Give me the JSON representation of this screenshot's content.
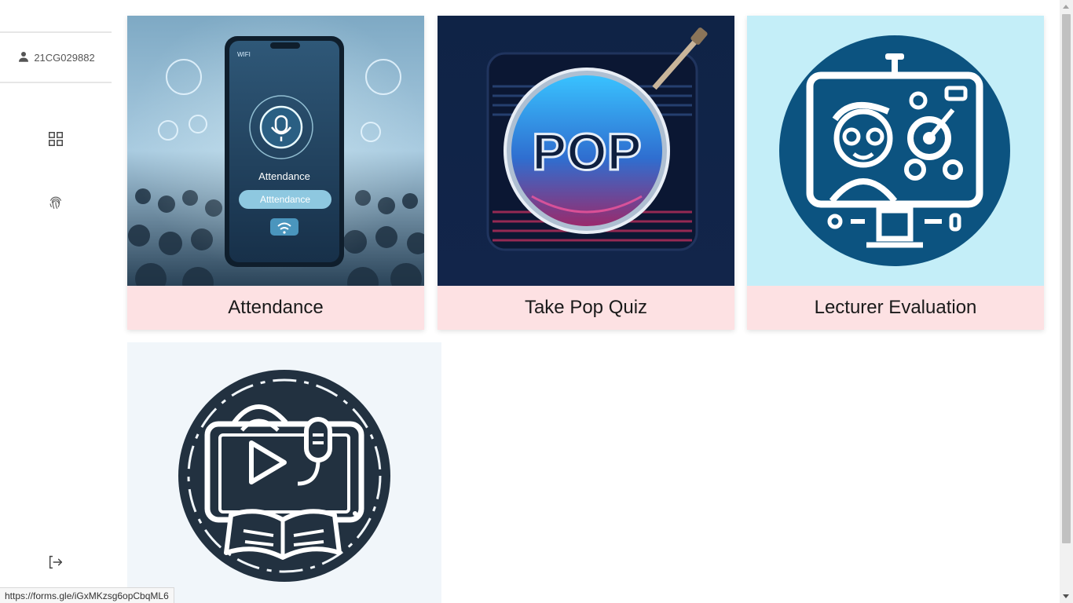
{
  "sidebar": {
    "user_id": "21CG029882",
    "icons": [
      "person-icon",
      "dashboard-grid-icon",
      "fingerprint-icon",
      "logout-icon"
    ]
  },
  "cards": [
    {
      "label": "Attendance",
      "icon": "attendance-illustration"
    },
    {
      "label": "Take Pop Quiz",
      "icon": "pop-quiz-illustration"
    },
    {
      "label": "Lecturer Evaluation",
      "icon": "lecturer-evaluation-illustration"
    },
    {
      "label": "",
      "icon": "media-learning-illustration"
    }
  ],
  "illustration_text": {
    "phone_wifi": "WIFI",
    "phone_title": "Attendance",
    "phone_button": "Atttendance",
    "pop_text": "POP"
  },
  "statusbar": {
    "url": "https://forms.gle/iGxMKzsg6opCbqML6"
  },
  "colors": {
    "card_label_bg": "#fde1e3",
    "evaluation_bg": "#c4eef8",
    "evaluation_circle": "#0c5380",
    "media_bg": "#f1f6fa",
    "media_circle": "#223140"
  }
}
